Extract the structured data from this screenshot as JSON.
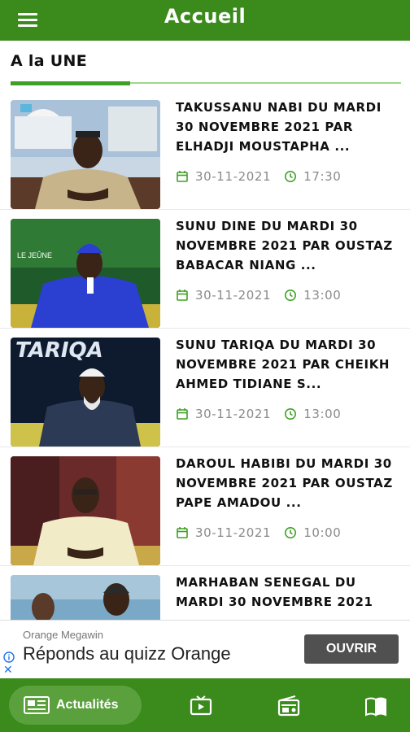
{
  "header": {
    "title": "Accueil",
    "menu_icon": "menu-icon"
  },
  "section": {
    "title": "A la UNE"
  },
  "articles": [
    {
      "title": "TAKUSSANU NABI DU MARDI 30 NOVEMBRE 2021 PAR ELHADJI MOUSTAPHA ...",
      "date": "30-11-2021",
      "time": "17:30"
    },
    {
      "title": "SUNU DINE DU MARDI 30 NOVEMBRE 2021 PAR OUSTAZ BABACAR NIANG ...",
      "date": "30-11-2021",
      "time": "13:00"
    },
    {
      "title": "SUNU TARIQA DU MARDI 30 NOVEMBRE 2021 PAR CHEIKH AHMED TIDIANE S...",
      "date": "30-11-2021",
      "time": "13:00"
    },
    {
      "title": "DAROUL HABIBI DU MARDI 30 NOVEMBRE 2021 PAR OUSTAZ PAPE AMADOU ...",
      "date": "30-11-2021",
      "time": "10:00"
    },
    {
      "title": "MARHABAN SENEGAL DU MARDI 30 NOVEMBRE 2021",
      "date": "",
      "time": ""
    }
  ],
  "thumb_texts": [
    "LE JEÛNE",
    "TARIQA"
  ],
  "ad": {
    "sponsor": "Orange Megawin",
    "text": "Réponds au quizz Orange",
    "button": "OUVRIR",
    "close": "✕"
  },
  "bottom_nav": {
    "active_label": "Actualités",
    "items": [
      "news-icon",
      "tv-icon",
      "radio-icon",
      "book-icon"
    ]
  },
  "colors": {
    "primary": "#3a8a1c",
    "accent": "#3fa024",
    "meta_icon": "#3fa024"
  }
}
